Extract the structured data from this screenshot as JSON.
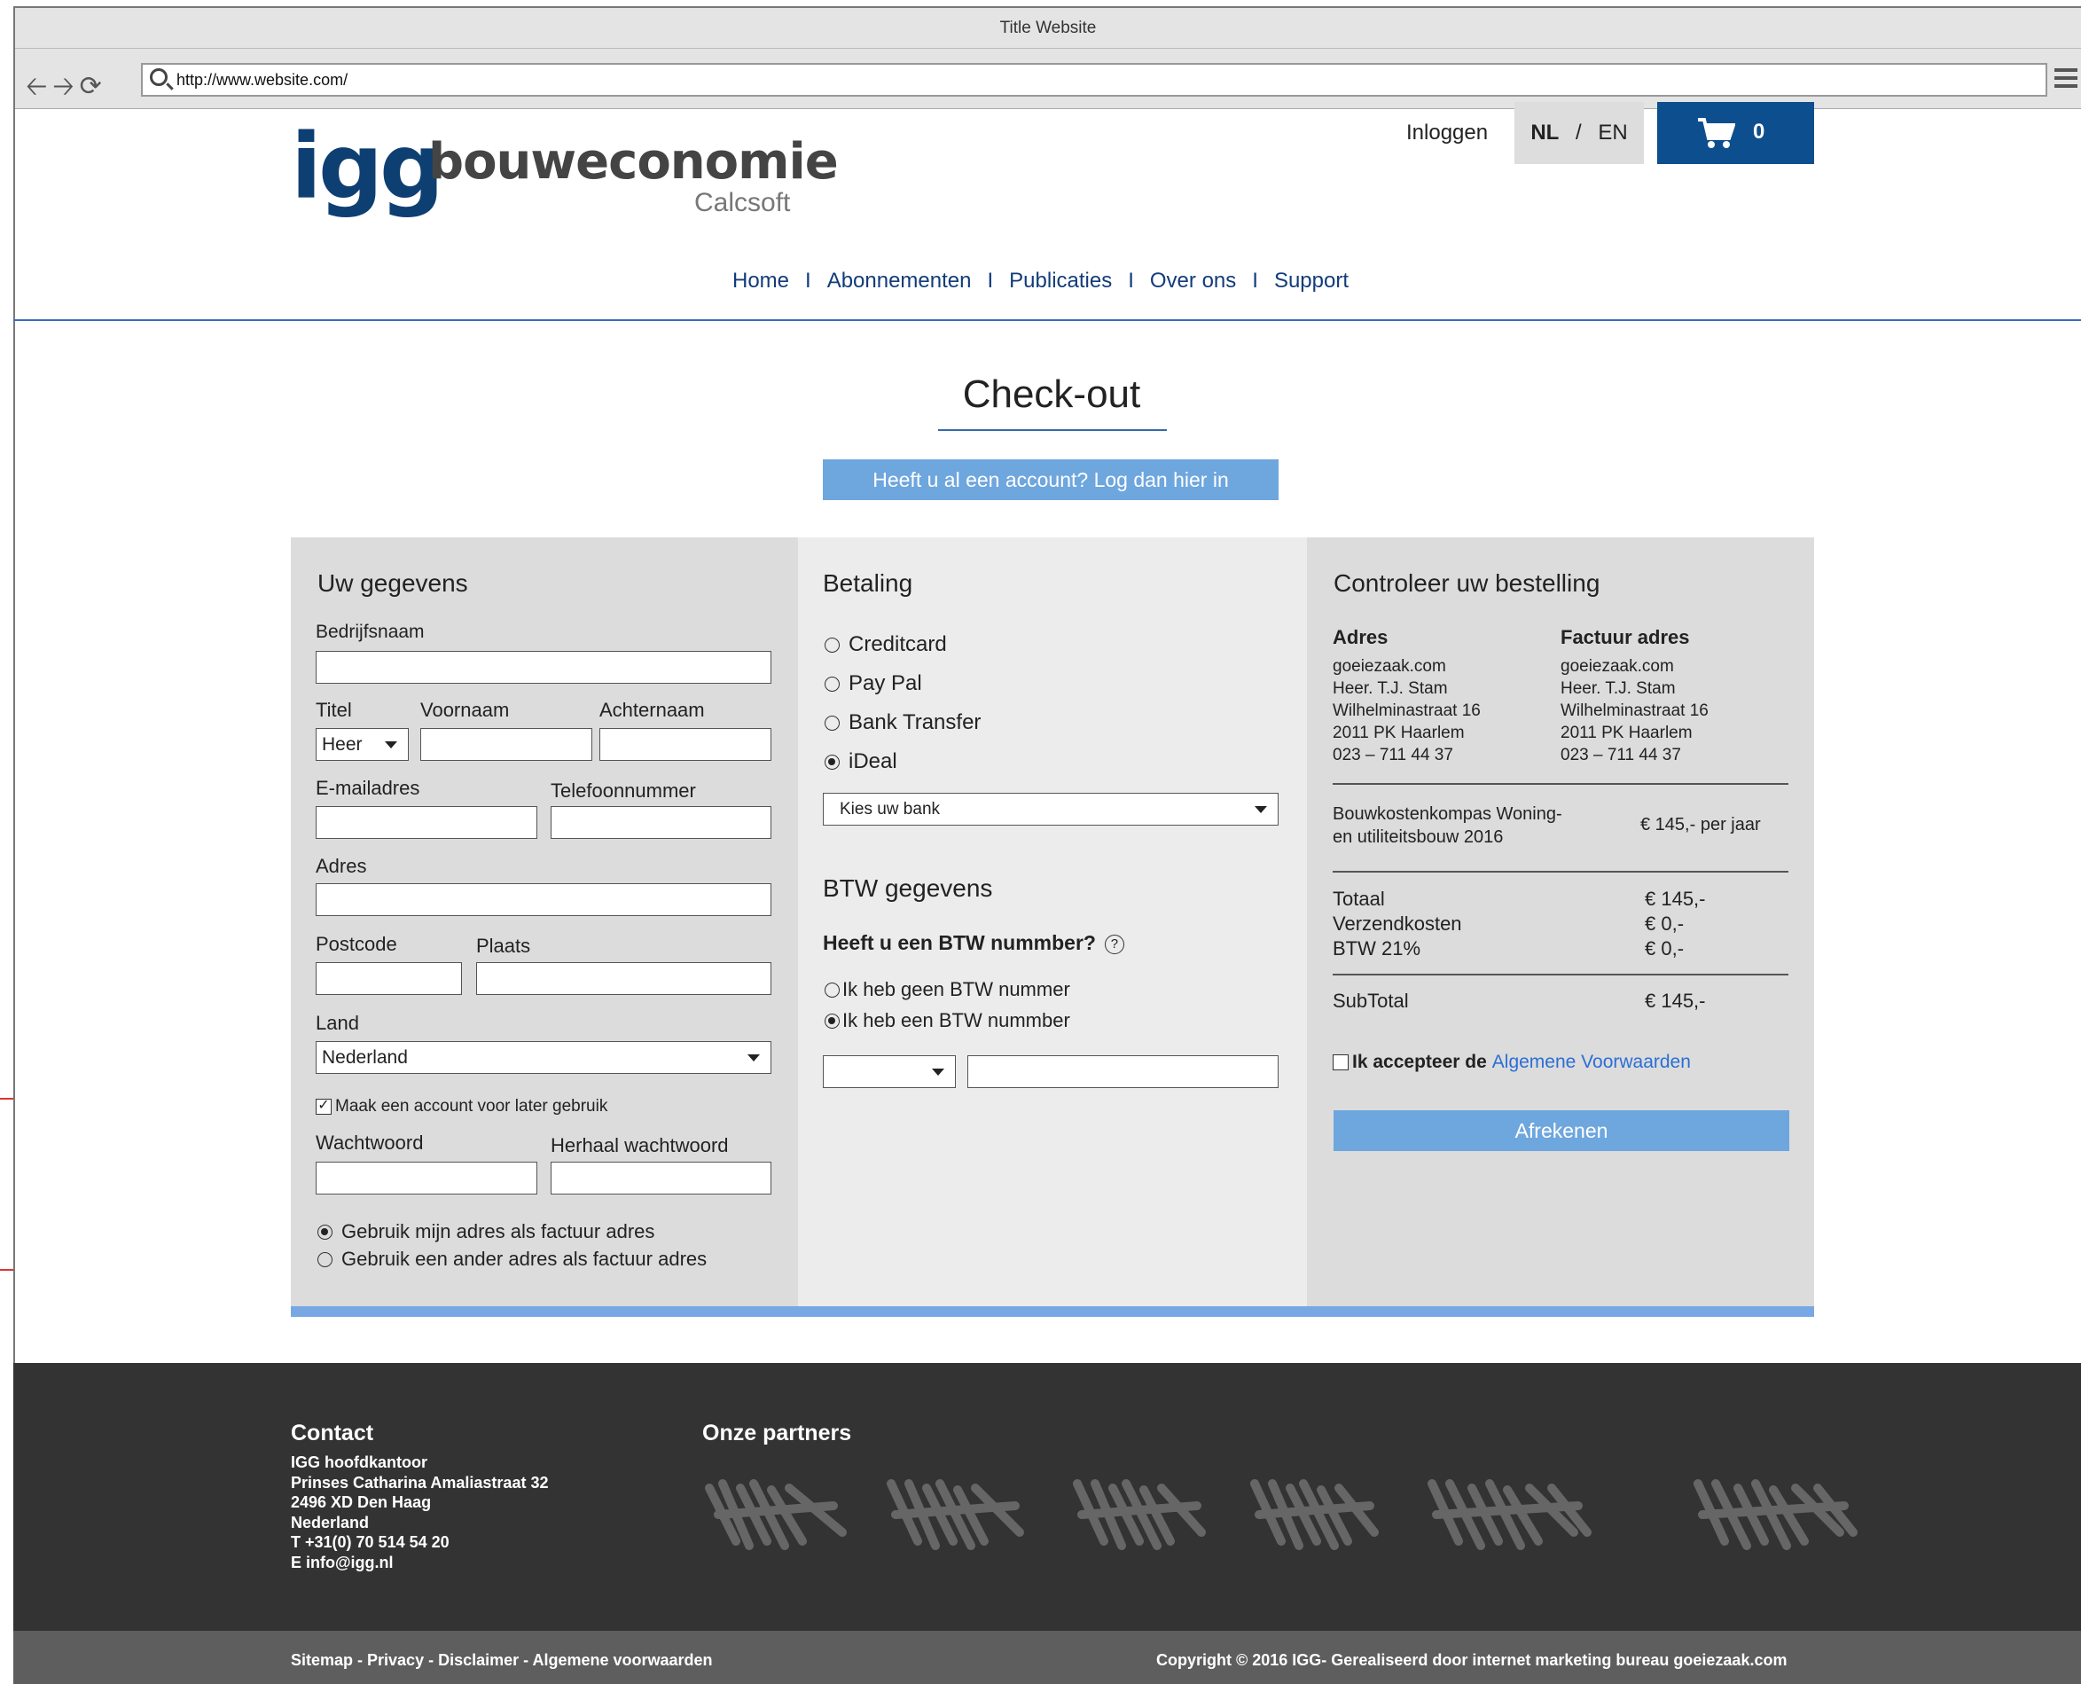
{
  "browser": {
    "title": "Title Website",
    "url": "http://www.website.com/"
  },
  "header": {
    "logo_main": "igg",
    "logo_brand": "bouweconomie",
    "logo_sub": "Calcsoft",
    "login": "Inloggen",
    "lang_nl": "NL",
    "lang_sep": "/",
    "lang_en": "EN",
    "cart_count": "0"
  },
  "nav": {
    "items": [
      "Home",
      "Abonnementen",
      "Publicaties",
      "Over ons",
      "Support"
    ],
    "separator": "I"
  },
  "page": {
    "title": "Check-out",
    "login_button": "Heeft u al een account? Log dan hier in"
  },
  "details": {
    "title": "Uw gegevens",
    "company_label": "Bedrijfsnaam",
    "title_label": "Titel",
    "title_value": "Heer",
    "firstname_label": "Voornaam",
    "lastname_label": "Achternaam",
    "email_label": "E-mailadres",
    "phone_label": "Telefoonnummer",
    "address_label": "Adres",
    "postcode_label": "Postcode",
    "city_label": "Plaats",
    "country_label": "Land",
    "country_value": "Nederland",
    "account_checkbox": "Maak een account voor later gebruik",
    "password_label": "Wachtwoord",
    "password_repeat_label": "Herhaal wachtwoord",
    "billing_same": "Gebruik  mijn adres als factuur adres",
    "billing_other": "Gebruik een ander adres als factuur adres"
  },
  "payment": {
    "title": "Betaling",
    "options": [
      "Creditcard",
      "Pay Pal",
      "Bank Transfer",
      "iDeal"
    ],
    "selected": "iDeal",
    "bank_placeholder": "Kies uw bank",
    "vat_title": "BTW gegevens",
    "vat_question": "Heeft u een BTW nummber?",
    "vat_none": "Ik heb geen BTW nummer",
    "vat_have": "Ik heb een BTW nummber"
  },
  "order": {
    "title": "Controleer uw bestelling",
    "address_head": "Adres",
    "invoice_head": "Factuur adres",
    "address_lines": [
      "goeiezaak.com",
      "Heer. T.J. Stam",
      "Wilhelminastraat 16",
      "2011 PK Haarlem",
      "023 – 711 44 37"
    ],
    "invoice_lines": [
      "goeiezaak.com",
      "Heer. T.J. Stam",
      "Wilhelminastraat 16",
      "2011 PK Haarlem",
      "023 – 711 44 37"
    ],
    "product_line1": "Bouwkostenkompas Woning-",
    "product_line2": "en utiliteitsbouw 2016",
    "product_price": "€ 145,-  per jaar",
    "total_label": "Totaal",
    "total_value": "€ 145,-",
    "shipping_label": "Verzendkosten",
    "shipping_value": "€ 0,-",
    "vat_label": "BTW 21%",
    "vat_value": "€ 0,-",
    "subtotal_label": "SubTotal",
    "subtotal_value": "€ 145,-",
    "terms_prefix": "Ik accepteer de",
    "terms_link": "Algemene Voorwaarden",
    "checkout_button": "Afrekenen"
  },
  "footer": {
    "contact_title": "Contact",
    "contact_lines": [
      "IGG hoofdkantoor",
      "Prinses Catharina Amaliastraat 32",
      "2496 XD Den Haag",
      "Nederland",
      "T +31(0) 70 514 54 20",
      "E info@igg.nl"
    ],
    "partners_title": "Onze partners",
    "links": "Sitemap - Privacy - Disclaimer - Algemene voorwaarden",
    "copyright": "Copyright © 2016 IGG- Gerealiseerd door internet marketing bureau goeiezaak.com"
  },
  "colors": {
    "brand_dark": "#0e3f73",
    "cart_blue": "#0d4e8f",
    "button_blue": "#6ea6de",
    "nav_blue": "#123c7a",
    "footer_dark": "#333333"
  }
}
